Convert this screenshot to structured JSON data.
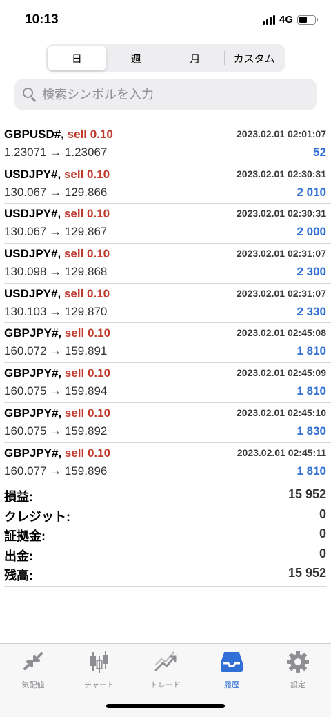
{
  "status": {
    "time": "10:13",
    "network": "4G"
  },
  "tabs": {
    "day": "日",
    "week": "週",
    "month": "月",
    "custom": "カスタム"
  },
  "search": {
    "placeholder": "検索シンボルを入力"
  },
  "deals": [
    {
      "symbol": "GBPUSD#,",
      "type": "sell 0.10",
      "time": "2023.02.01 02:01:07",
      "prices": "1.23071 → 1.23067",
      "profit": "52"
    },
    {
      "symbol": "USDJPY#,",
      "type": "sell 0.10",
      "time": "2023.02.01 02:30:31",
      "prices": "130.067 → 129.866",
      "profit": "2 010"
    },
    {
      "symbol": "USDJPY#,",
      "type": "sell 0.10",
      "time": "2023.02.01 02:30:31",
      "prices": "130.067 → 129.867",
      "profit": "2 000"
    },
    {
      "symbol": "USDJPY#,",
      "type": "sell 0.10",
      "time": "2023.02.01 02:31:07",
      "prices": "130.098 → 129.868",
      "profit": "2 300"
    },
    {
      "symbol": "USDJPY#,",
      "type": "sell 0.10",
      "time": "2023.02.01 02:31:07",
      "prices": "130.103 → 129.870",
      "profit": "2 330"
    },
    {
      "symbol": "GBPJPY#,",
      "type": "sell 0.10",
      "time": "2023.02.01 02:45:08",
      "prices": "160.072 → 159.891",
      "profit": "1 810"
    },
    {
      "symbol": "GBPJPY#,",
      "type": "sell 0.10",
      "time": "2023.02.01 02:45:09",
      "prices": "160.075 → 159.894",
      "profit": "1 810"
    },
    {
      "symbol": "GBPJPY#,",
      "type": "sell 0.10",
      "time": "2023.02.01 02:45:10",
      "prices": "160.075 → 159.892",
      "profit": "1 830"
    },
    {
      "symbol": "GBPJPY#,",
      "type": "sell 0.10",
      "time": "2023.02.01 02:45:11",
      "prices": "160.077 → 159.896",
      "profit": "1 810"
    }
  ],
  "summary": [
    {
      "label": "損益:",
      "value": "15 952"
    },
    {
      "label": "クレジット:",
      "value": "0"
    },
    {
      "label": "証拠金:",
      "value": "0"
    },
    {
      "label": "出金:",
      "value": "0"
    },
    {
      "label": "残高:",
      "value": "15 952"
    }
  ],
  "tabbar": {
    "quotes": "気配値",
    "chart": "チャート",
    "trade": "トレード",
    "history": "履歴",
    "settings": "設定"
  },
  "colors": {
    "accent": "#2f6fd6",
    "sell": "#c0392b",
    "inactive": "#8e8e93"
  }
}
